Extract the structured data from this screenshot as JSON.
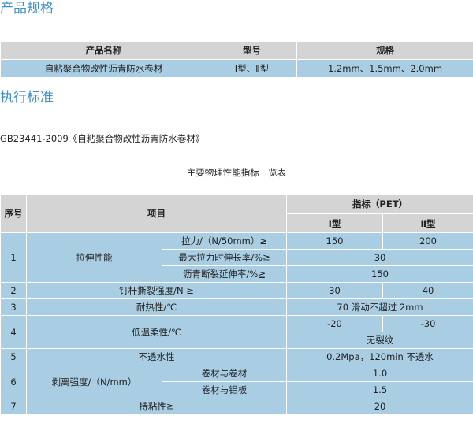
{
  "spec": {
    "heading": "产品规格",
    "headers": [
      "产品名称",
      "型号",
      "规格"
    ],
    "row": [
      "自粘聚合物改性沥青防水卷材",
      "Ⅰ型、Ⅱ型",
      "1.2mm、1.5mm、2.0mm"
    ]
  },
  "standard": {
    "heading": "执行标准",
    "code": "GB23441-2009《自粘聚合物改性沥青防水卷材》",
    "table_title": "主要物理性能指标一览表"
  },
  "perf": {
    "h_no": "序号",
    "h_item": "项目",
    "h_index": "指标（PET）",
    "h_type1": "Ⅰ型",
    "h_type2": "Ⅱ型",
    "r1": {
      "no": "1",
      "group": "拉伸性能",
      "a": "拉力/（N/50mm）≥",
      "a1": "150",
      "a2": "200",
      "b": "最大拉力时伸长率/%≧",
      "bv": "30",
      "c": "沥青断裂延伸率/%≧",
      "cv": "150"
    },
    "r2": {
      "no": "2",
      "item": "钉杆撕裂强度/N  ≥",
      "v1": "30",
      "v2": "40"
    },
    "r3": {
      "no": "3",
      "item": "耐热性/℃",
      "v": "70 滑动不超过 2mm"
    },
    "r4": {
      "no": "4",
      "item": "低温柔性/℃",
      "v1": "-20",
      "v2": "-30",
      "v3": "无裂纹"
    },
    "r5": {
      "no": "5",
      "item": "不透水性",
      "v": "0.2Mpa，120min 不透水"
    },
    "r6": {
      "no": "6",
      "group": "剥离强度/（N/mm）",
      "a": "卷材与卷材",
      "av": "1.0",
      "b": "卷材与铝板",
      "bv": "1.5"
    },
    "r7": {
      "no": "7",
      "item": "持粘性≧",
      "v": "20"
    }
  }
}
